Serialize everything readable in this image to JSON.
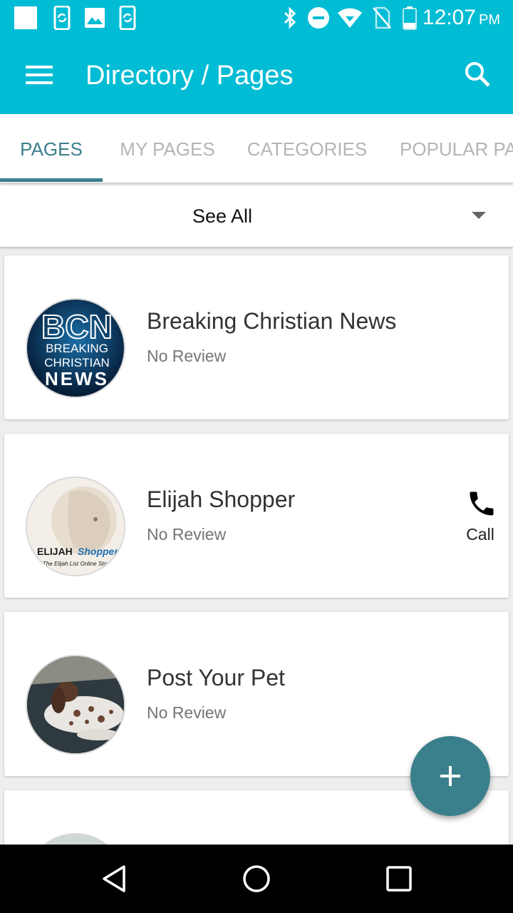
{
  "status_bar": {
    "time": "12:07",
    "ampm": "PM",
    "left_icons": [
      "notification-square-icon",
      "phone-sync-icon",
      "image-icon",
      "phone-sync-icon"
    ],
    "right_icons": [
      "bluetooth-icon",
      "do-not-disturb-icon",
      "wifi-icon",
      "no-sim-icon",
      "battery-icon"
    ]
  },
  "app_bar": {
    "title": "Directory / Pages",
    "background": "#00bcd4"
  },
  "tabs": [
    {
      "label": "PAGES",
      "active": true
    },
    {
      "label": "MY PAGES",
      "active": false
    },
    {
      "label": "CATEGORIES",
      "active": false
    },
    {
      "label": "POPULAR PAGES",
      "active": false
    }
  ],
  "filter": {
    "selected": "See All"
  },
  "pages": [
    {
      "title": "Breaking Christian News",
      "review": "No Review",
      "avatar": "bcn-logo",
      "avatar_text": [
        "BCN",
        "BREAKING",
        "CHRISTIAN",
        "NEWS"
      ]
    },
    {
      "title": "Elijah Shopper",
      "review": "No Review",
      "avatar": "elijah-shopper-logo",
      "avatar_text": [
        "ELIJAH",
        "Shopper",
        "The Elijah List Online Store"
      ],
      "call_label": "Call"
    },
    {
      "title": "Post Your Pet",
      "review": "No Review",
      "avatar": "dog-photo"
    }
  ],
  "accent_color": "#3a7f8c",
  "fab": {
    "icon": "plus-icon"
  },
  "nav_bar": {
    "icons": [
      "back-icon",
      "home-icon",
      "recents-icon"
    ]
  }
}
